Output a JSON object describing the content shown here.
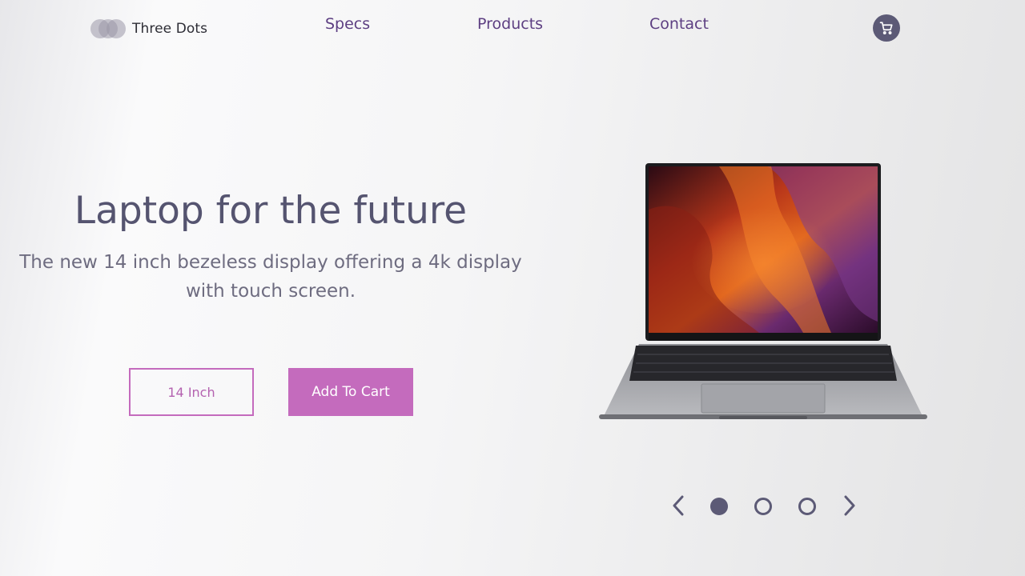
{
  "header": {
    "brand": "Three Dots",
    "logo_icon": "three-dots-logo-icon",
    "nav": [
      {
        "label": "Specs"
      },
      {
        "label": "Products"
      },
      {
        "label": "Contact"
      }
    ],
    "cart_icon": "shopping-cart-icon"
  },
  "hero": {
    "title": "Laptop for the future",
    "description_line1": "The new 14 inch bezeless display offering a 4k display",
    "description_line2": "with touch screen.",
    "option_button": "14 Inch",
    "cta_button": "Add To Cart",
    "image": "laptop-product-image"
  },
  "carousel": {
    "prev_icon": "chevron-left-icon",
    "next_icon": "chevron-right-icon",
    "slides": 3,
    "active_index": 0
  },
  "colors": {
    "accent": "#c46bbd",
    "nav_text": "#5d3f82",
    "heading": "#555470",
    "dark": "#5c5a76"
  }
}
